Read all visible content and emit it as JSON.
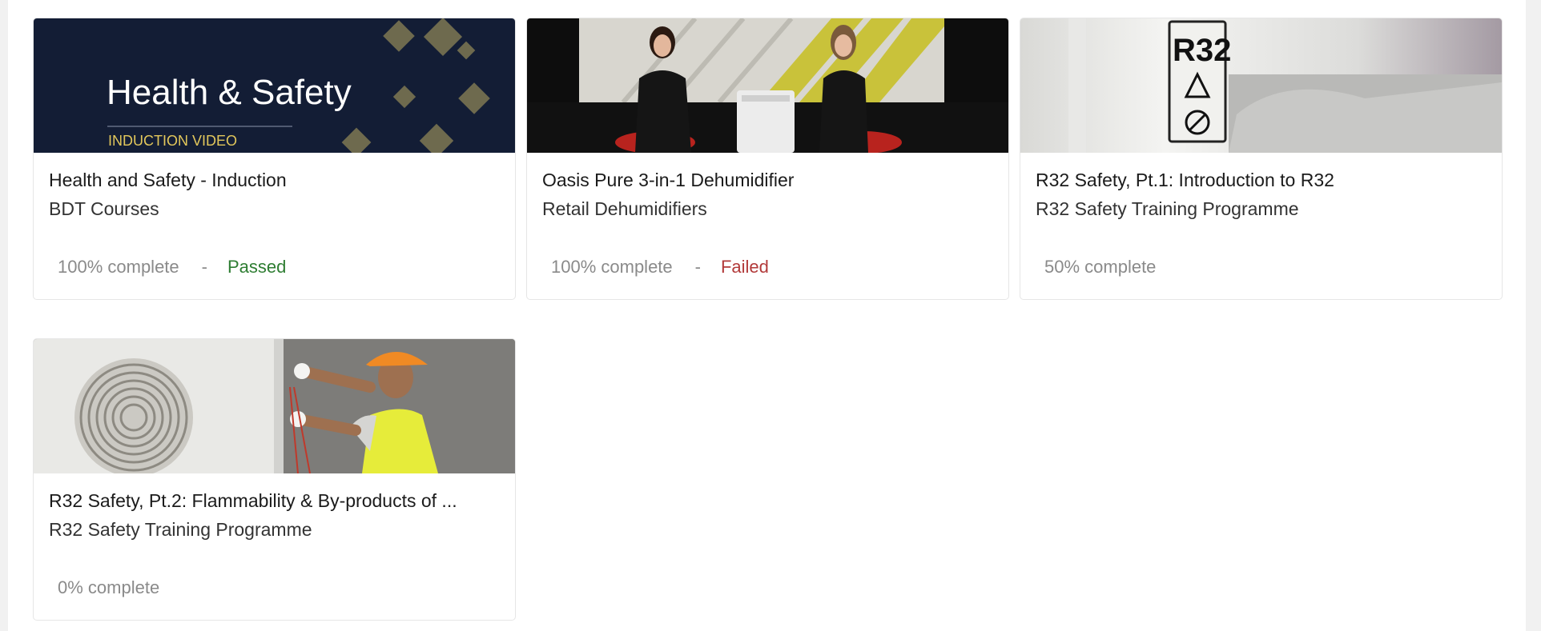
{
  "courses": [
    {
      "thumbnail": {
        "heading": "Health & Safety",
        "tag": "INDUCTION VIDEO",
        "bg_color": "#131d35",
        "accent_color": "#e2c75b"
      },
      "title": "Health and Safety - Induction",
      "subtitle": "BDT Courses",
      "progress": "100% complete",
      "separator": "-",
      "result": "Passed"
    },
    {
      "thumbnail": {
        "icon": "presenters-studio-image"
      },
      "title": "Oasis Pure 3-in-1 Dehumidifier",
      "subtitle": "Retail Dehumidifiers",
      "progress": "100% complete",
      "separator": "-",
      "result": "Failed"
    },
    {
      "thumbnail": {
        "label_text": "R32",
        "icon": "r32-warning-label-image"
      },
      "title": "R32 Safety, Pt.1: Introduction to R32",
      "subtitle": "R32 Safety Training Programme",
      "progress": "50% complete"
    },
    {
      "thumbnail": {
        "icon": "technician-outdoor-unit-image"
      },
      "title": "R32 Safety, Pt.2: Flammability & By-products of ...",
      "subtitle": "R32 Safety Training Programme",
      "progress": "0% complete"
    }
  ],
  "colors": {
    "passed": "#2e7d32",
    "failed": "#b23a3a",
    "muted_text": "#8a8a8a"
  }
}
